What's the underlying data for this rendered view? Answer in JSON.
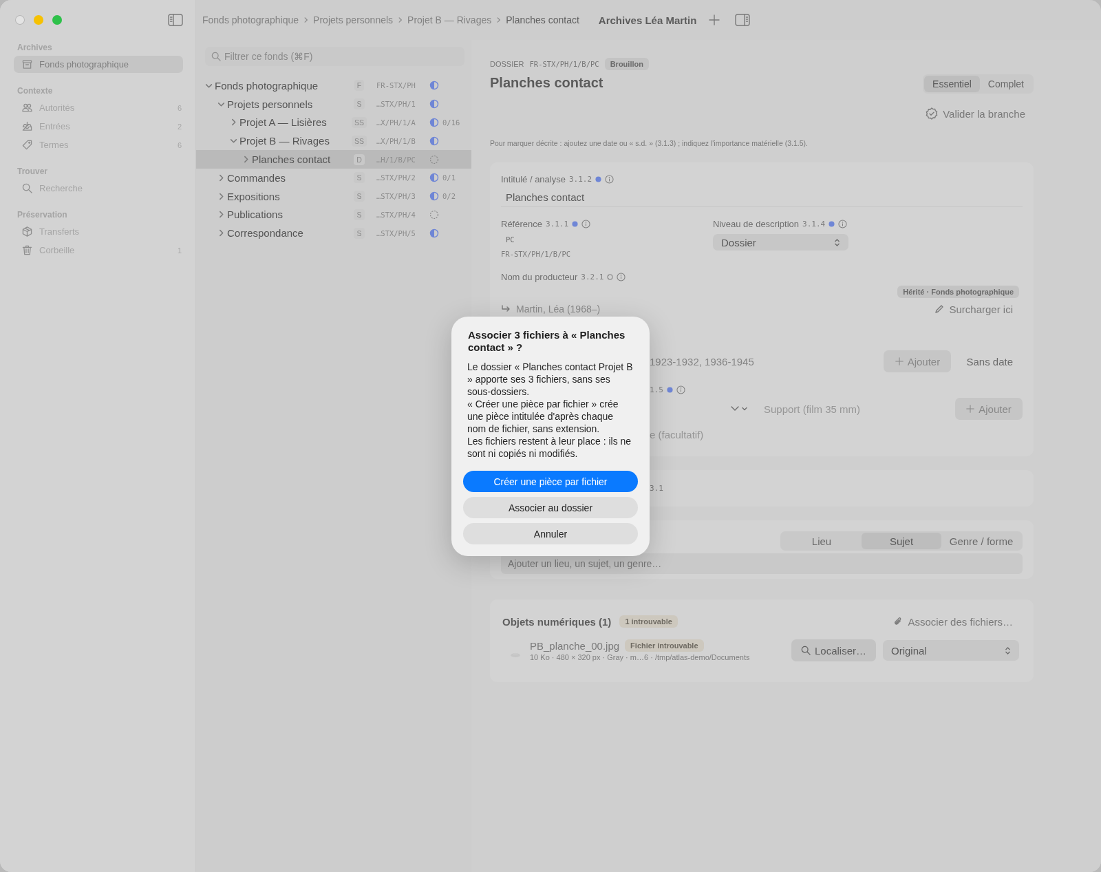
{
  "window": {
    "title": "Archives Léa Martin"
  },
  "sidebar": {
    "sections": [
      {
        "title": "Archives",
        "items": [
          {
            "label": "Fonds photographique",
            "selected": true
          }
        ]
      },
      {
        "title": "Contexte",
        "items": [
          {
            "label": "Autorités",
            "count": "6",
            "selected": false
          },
          {
            "label": "Entrées",
            "count": "2",
            "selected": false
          },
          {
            "label": "Termes",
            "count": "6",
            "selected": false
          }
        ]
      },
      {
        "title": "Trouver",
        "items": [
          {
            "label": "Recherche",
            "selected": false
          }
        ]
      },
      {
        "title": "Préservation",
        "items": [
          {
            "label": "Transferts",
            "selected": false
          },
          {
            "label": "Corbeille",
            "count": "1",
            "selected": false
          }
        ]
      }
    ]
  },
  "breadcrumb": [
    "Fonds photographique",
    "Projets personnels",
    "Projet B — Rivages",
    "Planches contact"
  ],
  "tree": {
    "search": {
      "placeholder": "Filtrer ce fonds (⌘F)"
    },
    "nodes": [
      {
        "label": "Fonds photographique",
        "level": "F",
        "reference": "FR-STX/PH",
        "started": true,
        "expanded": true,
        "selected": false,
        "children": [
          {
            "label": "Projets personnels",
            "level": "S",
            "reference": "…STX/PH/1",
            "started": true,
            "expanded": true,
            "selected": false,
            "children": [
              {
                "label": "Projet A — Lisières",
                "level": "SS",
                "reference": "…X/PH/1/A",
                "started": true,
                "count": "0/16",
                "expanded": false,
                "selected": false
              },
              {
                "label": "Projet B — Rivages",
                "level": "SS",
                "reference": "…X/PH/1/B",
                "started": true,
                "expanded": true,
                "selected": false,
                "children": [
                  {
                    "label": "Planches contact",
                    "level": "D",
                    "reference": "…H/1/B/PC",
                    "started": false,
                    "expanded": false,
                    "selected": true
                  }
                ]
              }
            ]
          },
          {
            "label": "Commandes",
            "level": "S",
            "reference": "…STX/PH/2",
            "started": true,
            "count": "0/1",
            "expanded": false,
            "selected": false
          },
          {
            "label": "Expositions",
            "level": "S",
            "reference": "…STX/PH/3",
            "started": true,
            "count": "0/2",
            "expanded": false,
            "selected": false
          },
          {
            "label": "Publications",
            "level": "S",
            "reference": "…STX/PH/4",
            "started": false,
            "expanded": false,
            "selected": false
          },
          {
            "label": "Correspondance",
            "level": "S",
            "reference": "…STX/PH/5",
            "started": true,
            "expanded": false,
            "selected": false
          }
        ]
      }
    ]
  },
  "record": {
    "level": "DOSSIER",
    "reference": "FR-STX/PH/1/B/PC",
    "status_badge": "Brouillon",
    "title": "Planches contact",
    "view_modes": [
      {
        "label": "Essentiel",
        "selected": true
      },
      {
        "label": "Complet",
        "selected": false
      }
    ],
    "validate_button": "Valider la branche",
    "hint": "Pour marquer décrite : ajoutez une date ou « s.d. » (3.1.3) ; indiquez l'importance matérielle (3.1.5).",
    "title_field": {
      "label": "Intitulé / analyse",
      "code": "3.1.2",
      "filled": true,
      "value": "Planches contact"
    },
    "reference_field": {
      "label": "Référence",
      "code": "3.1.1",
      "filled": true,
      "value": "PC",
      "full_reference": "FR-STX/PH/1/B/PC"
    },
    "level_field": {
      "label": "Niveau de description",
      "code": "3.1.4",
      "filled": true,
      "value": "Dossier"
    },
    "creator_field": {
      "label": "Nom du producteur",
      "code": "3.2.1",
      "filled": false,
      "inherited_badge": "Hérité · Fonds photographique",
      "value": "Martin, Léa (1968–)",
      "override_button": "Surcharger ici"
    },
    "dates_row": {
      "value": "1923-1932, 1936-1945",
      "add_button": "Ajouter",
      "undated_button": "Sans date"
    },
    "extent_field": {
      "code": "1.5",
      "filled": true
    },
    "extent_row": {
      "placeholder": "Support (film 35 mm)",
      "add_button": "Ajouter"
    },
    "note_field": {
      "placeholder": "e (facultatif)"
    },
    "second_card": {
      "code": "3.1"
    },
    "index_card": {
      "tabs": [
        {
          "label": "Lieu",
          "selected": false
        },
        {
          "label": "Sujet",
          "selected": true
        },
        {
          "label": "Genre / forme",
          "selected": false
        }
      ],
      "placeholder": "Ajouter un lieu, un sujet, un genre…"
    },
    "digital_objects": {
      "title": "Objets numériques (1)",
      "badge": "1 introuvable",
      "attach_button": "Associer des fichiers…",
      "files": [
        {
          "name": "PB_planche_00.jpg",
          "badge": "Fichier introuvable",
          "meta": "10 Ko · 480 × 320 px · Gray · m…6 · /tmp/atlas-demo/Documents",
          "locate_button": "Localiser…",
          "version": "Original"
        }
      ]
    }
  },
  "dialog": {
    "title": "Associer 3 fichiers à « Planches contact » ?",
    "paragraphs": [
      "Le dossier « Planches contact Projet B » apporte ses 3 fichiers, sans ses sous-dossiers.",
      "« Créer une pièce par fichier » crée une pièce intitulée d'après chaque nom de fichier, sans extension.",
      "Les fichiers restent à leur place : ils ne sont ni copiés ni modifiés."
    ],
    "buttons": [
      {
        "label": "Créer une pièce par fichier",
        "kind": "primary"
      },
      {
        "label": "Associer au dossier",
        "kind": "secondary"
      },
      {
        "label": "Annuler",
        "kind": "secondary"
      }
    ]
  }
}
